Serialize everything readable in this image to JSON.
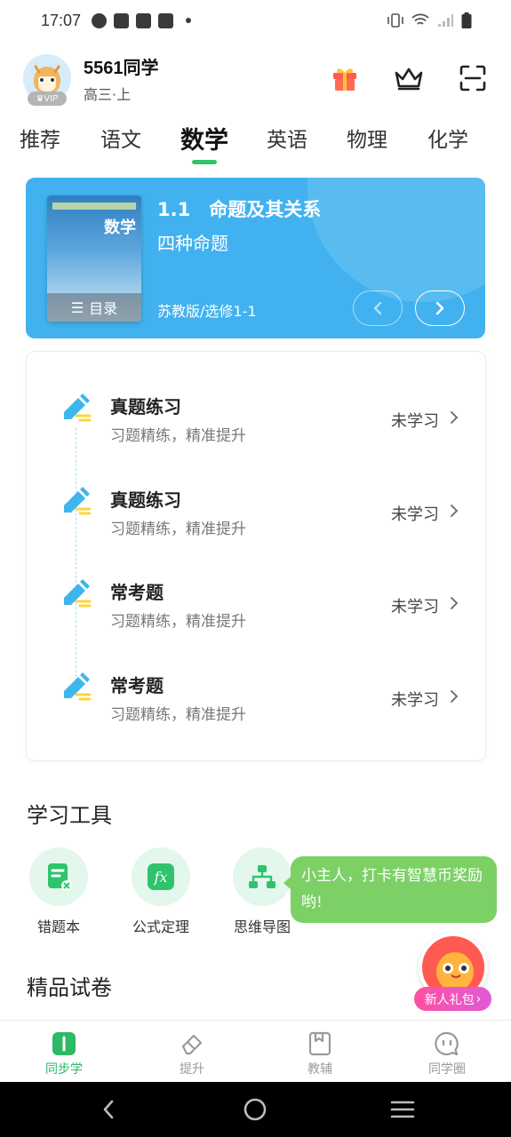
{
  "status_bar": {
    "time": "17:07",
    "icons": [
      "clock-icon",
      "mail-icon",
      "mail-icon",
      "mail-icon",
      "dot-icon",
      "vibrate-icon",
      "wifi-icon",
      "signal-icon",
      "battery-icon"
    ]
  },
  "header": {
    "user_name": "5561同学",
    "grade": "高三·上",
    "vip_label": "VIP",
    "actions": [
      "gift-icon",
      "crown-icon",
      "scan-icon"
    ]
  },
  "tabs": [
    {
      "label": "推荐",
      "active": false
    },
    {
      "label": "语文",
      "active": false
    },
    {
      "label": "数学",
      "active": true
    },
    {
      "label": "英语",
      "active": false
    },
    {
      "label": "物理",
      "active": false
    },
    {
      "label": "化学",
      "active": false
    }
  ],
  "book_card": {
    "cover_title": "数学",
    "toc_label": "目录",
    "chapter_title": "1.1　命题及其关系",
    "chapter_subtitle": "四种命题",
    "edition": "苏教版/选修1-1",
    "accent": "#41b2ef"
  },
  "exercises": [
    {
      "title": "真题练习",
      "desc": "习题精练，精准提升",
      "status": "未学习"
    },
    {
      "title": "真题练习",
      "desc": "习题精练，精准提升",
      "status": "未学习"
    },
    {
      "title": "常考题",
      "desc": "习题精练，精准提升",
      "status": "未学习"
    },
    {
      "title": "常考题",
      "desc": "习题精练，精准提升",
      "status": "未学习"
    }
  ],
  "tools": {
    "title": "学习工具",
    "items": [
      {
        "label": "错题本",
        "icon": "wrong-book-icon"
      },
      {
        "label": "公式定理",
        "icon": "formula-icon"
      },
      {
        "label": "思维导图",
        "icon": "mind-map-icon"
      }
    ]
  },
  "bubble_text": "小主人，打卡有智慧币奖励哟!",
  "gift_pill": {
    "label": "新人礼包",
    "arrow": "›"
  },
  "papers_title": "精品试卷",
  "bottom_nav": [
    {
      "label": "同步学",
      "icon": "book-icon",
      "active": true
    },
    {
      "label": "提升",
      "icon": "eraser-icon",
      "active": false
    },
    {
      "label": "教辅",
      "icon": "tutor-book-icon",
      "active": false
    },
    {
      "label": "同学圈",
      "icon": "chat-icon",
      "active": false
    }
  ],
  "colors": {
    "brand_green": "#33c36a",
    "card_blue": "#41b2ef",
    "bubble_green": "#7cd065"
  }
}
